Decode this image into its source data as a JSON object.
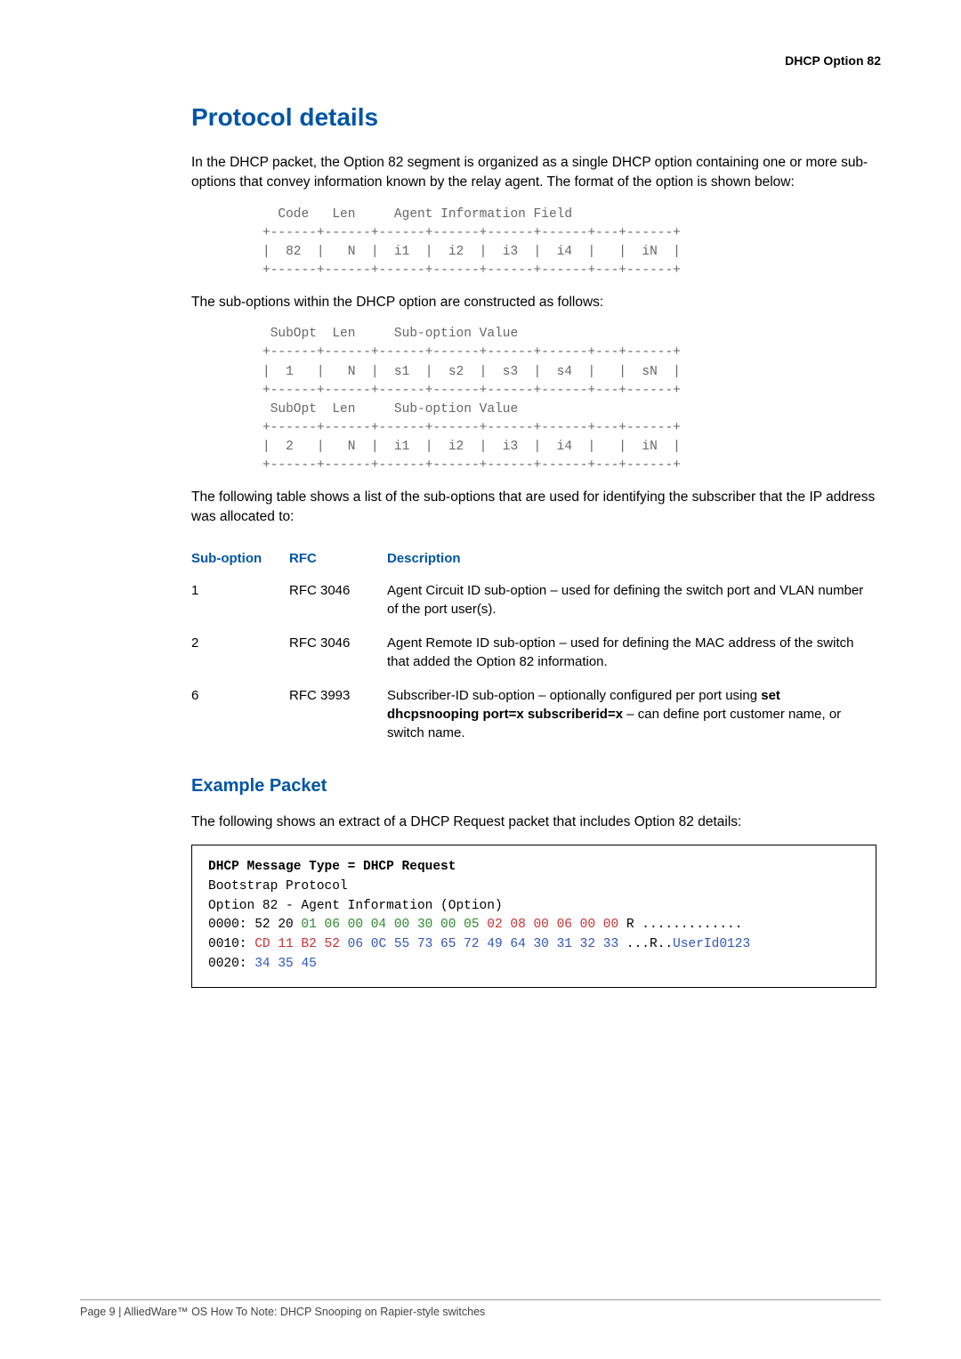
{
  "header": {
    "title": "DHCP Option 82"
  },
  "main": {
    "h1": "Protocol details",
    "intro": "In the DHCP packet, the Option 82 segment is organized as a single DHCP option containing one or more sub-options that convey information known by the relay agent. The format of the option is shown below:",
    "diagram1": "  Code   Len     Agent Information Field\n+------+------+------+------+------+------+---+------+\n|  82  |   N  |  i1  |  i2  |  i3  |  i4  |   |  iN  |\n+------+------+------+------+------+------+---+------+",
    "sub_intro": "The sub-options within the DHCP option are constructed as follows:",
    "diagram2": " SubOpt  Len     Sub-option Value\n+------+------+------+------+------+------+---+------+\n|  1   |   N  |  s1  |  s2  |  s3  |  s4  |   |  sN  |\n+------+------+------+------+------+------+---+------+\n SubOpt  Len     Sub-option Value\n+------+------+------+------+------+------+---+------+\n|  2   |   N  |  i1  |  i2  |  i3  |  i4  |   |  iN  |\n+------+------+------+------+------+------+---+------+",
    "table_intro": "The following table shows a list of the sub-options that are used for identifying the subscriber that the IP address was allocated to:",
    "table": {
      "headers": {
        "c1": "Sub-option",
        "c2": "RFC",
        "c3": "Description"
      },
      "rows": [
        {
          "c1": "1",
          "c2": "RFC 3046",
          "c3_a": "Agent Circuit ID sub-option – used for defining the switch port and VLAN number of the port user(s)."
        },
        {
          "c1": "2",
          "c2": "RFC 3046",
          "c3_a": "Agent Remote ID sub-option – used for defining the MAC address of the switch that added the Option 82 information."
        },
        {
          "c1": "6",
          "c2": "RFC 3993",
          "c3_a": "Subscriber-ID sub-option – optionally configured per port using ",
          "c3_b": "set dhcpsnooping port=x subscriberid=x",
          "c3_c": " – can define port customer name, or switch name."
        }
      ]
    },
    "example": {
      "h2": "Example Packet",
      "intro": "The following shows an extract of a DHCP Request packet that includes Option 82 details:",
      "line1_b": "DHCP Message Type = DHCP Request",
      "line2": "Bootstrap Protocol",
      "line3": "Option 82 - Agent Information (Option)",
      "l4_a": "0000:  52 20 ",
      "l4_g": "01 06 00 04 00 30 00 05 ",
      "l4_r": "02 08 00 06 00 00",
      "l4_t": "  R .............",
      "l5_a": "0010:  ",
      "l5_r": "CD 11 B2 52 ",
      "l5_bl": "06 0C 55 73 65 72 49 64 30 31 32 33",
      "l5_t1": "  ...R..",
      "l5_t2": "UserId0123",
      "l6_a": "0020:  ",
      "l6_bl": "34 35                                          ",
      "l6_t": "45"
    }
  },
  "footer": {
    "text": "Page 9 | AlliedWare™ OS How To Note: DHCP Snooping on Rapier-style switches"
  }
}
